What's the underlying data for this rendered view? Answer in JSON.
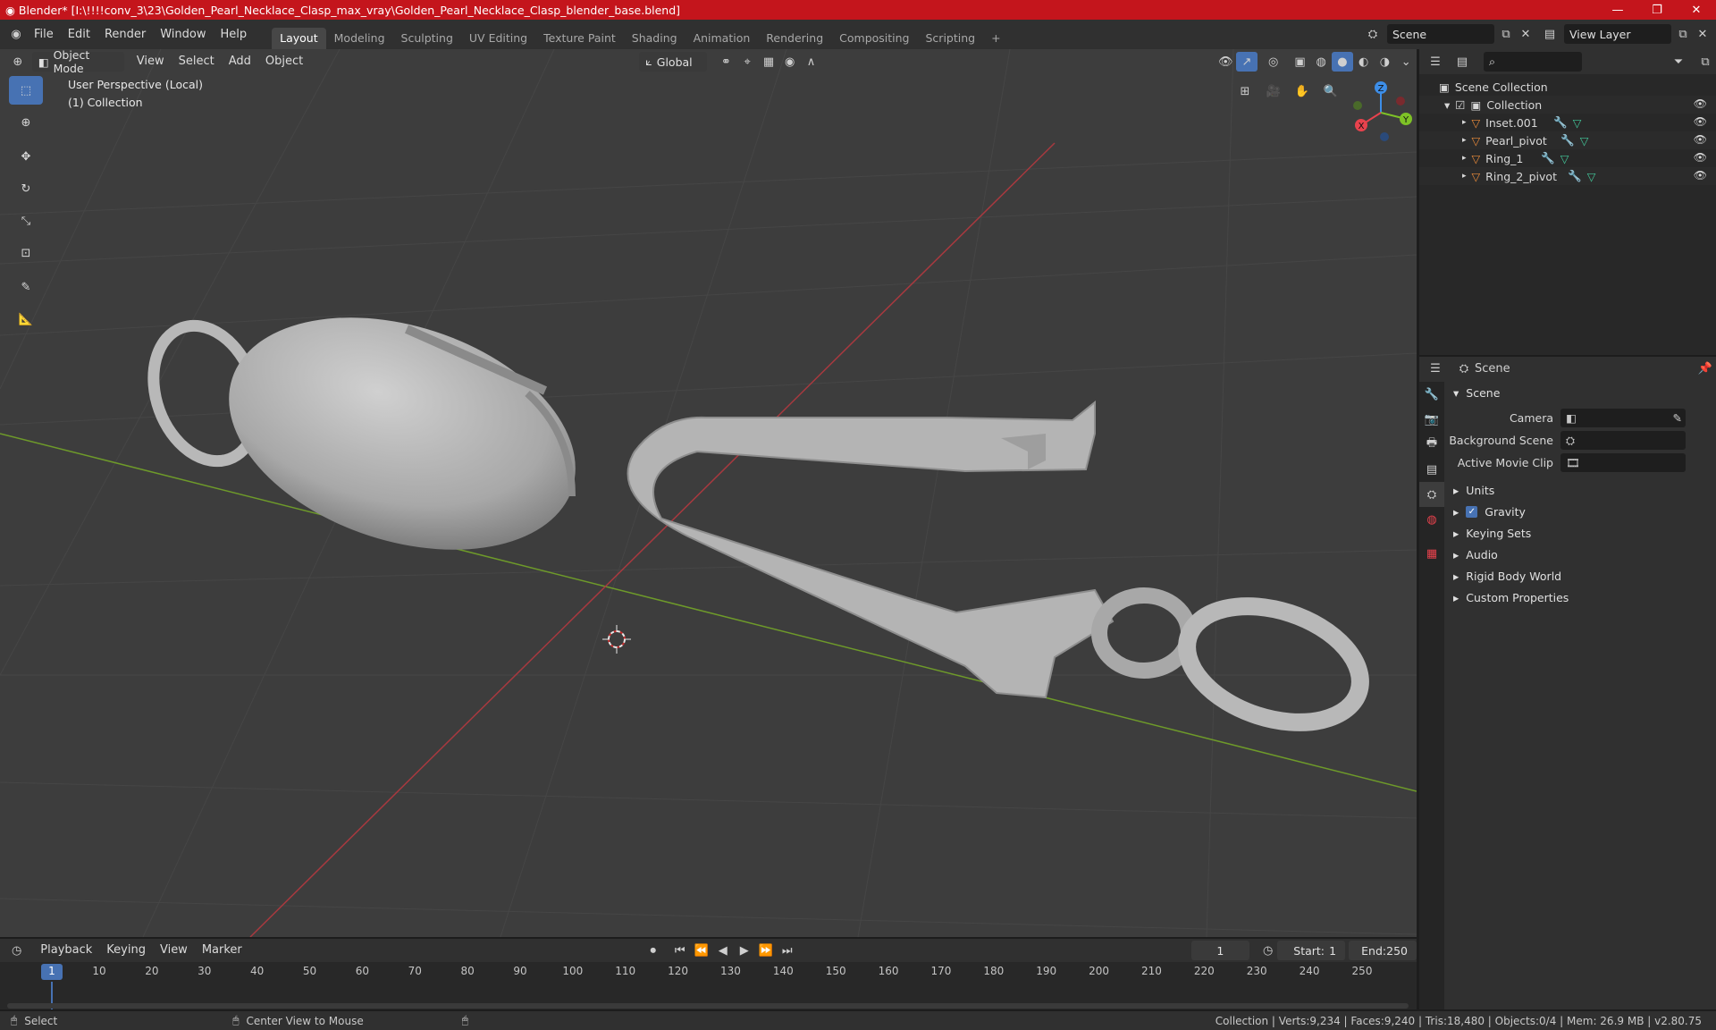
{
  "window": {
    "title": "Blender* [I:\\!!!!conv_3\\23\\Golden_Pearl_Necklace_Clasp_max_vray\\Golden_Pearl_Necklace_Clasp_blender_base.blend]",
    "minimize": "—",
    "maximize": "❐",
    "close": "✕"
  },
  "menu": [
    "File",
    "Edit",
    "Render",
    "Window",
    "Help"
  ],
  "workspaces": [
    "Layout",
    "Modeling",
    "Sculpting",
    "UV Editing",
    "Texture Paint",
    "Shading",
    "Animation",
    "Rendering",
    "Compositing",
    "Scripting"
  ],
  "workspace_add": "+",
  "scene_field": "Scene",
  "view_layer_field": "View Layer",
  "viewport": {
    "mode": "Object Mode",
    "menus": [
      "View",
      "Select",
      "Add",
      "Object"
    ],
    "orientation": "Global",
    "info_line1": "User Perspective (Local)",
    "info_line2": "(1) Collection",
    "gizmo": {
      "x": "X",
      "y": "Y",
      "z": "Z"
    }
  },
  "outliner": {
    "root": "Scene Collection",
    "collection": "Collection",
    "items": [
      "Inset.001",
      "Pearl_pivot",
      "Ring_1",
      "Ring_2_pivot"
    ]
  },
  "properties": {
    "header": "Scene",
    "panel": "Scene",
    "rows": [
      {
        "label": "Camera"
      },
      {
        "label": "Background Scene"
      },
      {
        "label": "Active Movie Clip"
      }
    ],
    "subpanels": [
      "Units",
      "Gravity",
      "Keying Sets",
      "Audio",
      "Rigid Body World",
      "Custom Properties"
    ]
  },
  "timeline": {
    "menus": [
      "Playback",
      "Keying",
      "View",
      "Marker"
    ],
    "current_frame": "1",
    "start_label": "Start:",
    "start": "1",
    "end_label": "End:",
    "end": "250",
    "ticks": [
      "1",
      "10",
      "20",
      "30",
      "40",
      "50",
      "60",
      "70",
      "80",
      "90",
      "100",
      "110",
      "120",
      "130",
      "140",
      "150",
      "160",
      "170",
      "180",
      "190",
      "200",
      "210",
      "220",
      "230",
      "240",
      "250"
    ]
  },
  "status": {
    "select": "Select",
    "center_view": "Center View to Mouse",
    "stats": "Collection | Verts:9,234 | Faces:9,240 | Tris:18,480 | Objects:0/4 | Mem: 26.9 MB | v2.80.75"
  },
  "colors": {
    "titlebar": "#c4151c",
    "active_tool": "#4772b3",
    "axis_x": "#e8424d",
    "axis_y": "#7ec226",
    "axis_z": "#3d8ee8",
    "object_icon": "#e88a3a",
    "modifier_icon": "#68a8e8",
    "mesh_icon": "#43c79a"
  }
}
